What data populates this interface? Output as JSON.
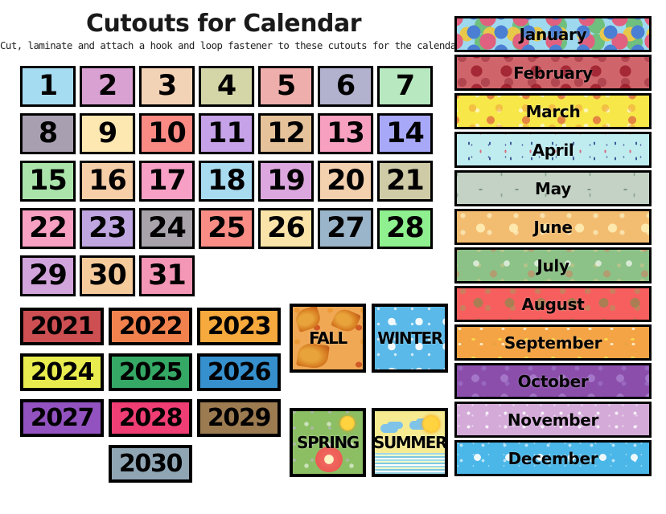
{
  "header": {
    "title": "Cutouts for Calendar",
    "subtitle": "Cut, laminate and attach a hook and loop fastener to these cutouts for the calendar."
  },
  "number_tiles": [
    {
      "label": "1",
      "bg": "#a6dcf2"
    },
    {
      "label": "2",
      "bg": "#d9a0d2"
    },
    {
      "label": "3",
      "bg": "#f3d3b5"
    },
    {
      "label": "4",
      "bg": "#d5d6a8"
    },
    {
      "label": "5",
      "bg": "#eeaeab"
    },
    {
      "label": "6",
      "bg": "#b2b2cf"
    },
    {
      "label": "7",
      "bg": "#b8e8bf"
    },
    {
      "label": "8",
      "bg": "#a8a0b0"
    },
    {
      "label": "9",
      "bg": "#fce8b0"
    },
    {
      "label": "10",
      "bg": "#f98a84"
    },
    {
      "label": "11",
      "bg": "#c6a3e8"
    },
    {
      "label": "12",
      "bg": "#e5c29a"
    },
    {
      "label": "13",
      "bg": "#f8a0c0"
    },
    {
      "label": "14",
      "bg": "#a8a8f8"
    },
    {
      "label": "15",
      "bg": "#aae4ab"
    },
    {
      "label": "16",
      "bg": "#f6cfa8"
    },
    {
      "label": "17",
      "bg": "#f79fc4"
    },
    {
      "label": "18",
      "bg": "#a8daf0"
    },
    {
      "label": "19",
      "bg": "#dca7de"
    },
    {
      "label": "20",
      "bg": "#f3d0ae"
    },
    {
      "label": "21",
      "bg": "#cfcba6"
    },
    {
      "label": "22",
      "bg": "#f7a0c2"
    },
    {
      "label": "23",
      "bg": "#bfa6e0"
    },
    {
      "label": "24",
      "bg": "#a8a3ab"
    },
    {
      "label": "25",
      "bg": "#f98d85"
    },
    {
      "label": "26",
      "bg": "#fae3a8"
    },
    {
      "label": "27",
      "bg": "#9ab4c9"
    },
    {
      "label": "28",
      "bg": "#8ef08e"
    },
    {
      "label": "29",
      "bg": "#d2a4dc"
    },
    {
      "label": "30",
      "bg": "#f6cb9c"
    },
    {
      "label": "31",
      "bg": "#f496b5"
    }
  ],
  "year_tiles": [
    {
      "label": "2021",
      "bg": "#cd4f52"
    },
    {
      "label": "2022",
      "bg": "#f1824e"
    },
    {
      "label": "2023",
      "bg": "#f6a93c"
    },
    {
      "label": "2024",
      "bg": "#e8ec4e"
    },
    {
      "label": "2025",
      "bg": "#35a865"
    },
    {
      "label": "2026",
      "bg": "#3690ce"
    },
    {
      "label": "2027",
      "bg": "#9253c0"
    },
    {
      "label": "2028",
      "bg": "#ef3e74"
    },
    {
      "label": "2029",
      "bg": "#9d7b51"
    },
    {
      "label": "2030",
      "bg": "#8fa5b4"
    }
  ],
  "season_tiles": [
    {
      "label": "FALL",
      "bg": "#f0a855",
      "pattern": "fall-leaves-pattern"
    },
    {
      "label": "WINTER",
      "bg": "#5ab9e8",
      "pattern": "snowflakes-pattern"
    },
    {
      "label": "SPRING",
      "bg": "#8cbf63",
      "pattern": "flowers-pattern"
    },
    {
      "label": "SUMMER",
      "bg": "#f7eb92",
      "pattern": "sun-water-pattern"
    }
  ],
  "month_banners": [
    {
      "label": "January",
      "bg": "#9ed9ef",
      "pattern": "confetti-pattern"
    },
    {
      "label": "February",
      "bg": "#d0646b",
      "pattern": "hearts-pattern"
    },
    {
      "label": "March",
      "bg": "#f7e749",
      "pattern": "sparkles-pattern"
    },
    {
      "label": "April",
      "bg": "#bfecef",
      "pattern": "raindrops-pattern"
    },
    {
      "label": "May",
      "bg": "#c3d2c5",
      "pattern": "leaf-sprigs-pattern"
    },
    {
      "label": "June",
      "bg": "#f3bd71",
      "pattern": "pale-dots-pattern"
    },
    {
      "label": "July",
      "bg": "#8cc187",
      "pattern": "green-sparkles-pattern"
    },
    {
      "label": "August",
      "bg": "#f75f5f",
      "pattern": "swirls-pattern"
    },
    {
      "label": "September",
      "bg": "#f4a444",
      "pattern": "petals-pattern"
    },
    {
      "label": "October",
      "bg": "#8b4fab",
      "pattern": "spirals-pattern"
    },
    {
      "label": "November",
      "bg": "#d4aad9",
      "pattern": "white-dots-pattern"
    },
    {
      "label": "December",
      "bg": "#4ab7e8",
      "pattern": "snow-pattern"
    }
  ]
}
